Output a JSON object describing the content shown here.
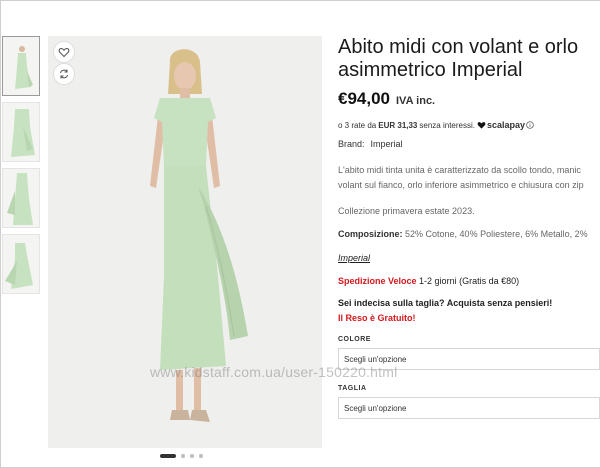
{
  "product": {
    "title_line1": "Abito midi con volant e orlo",
    "title_line2": "asimmetrico Imperial",
    "price": "€94,00",
    "vat": "IVA inc.",
    "rate_prefix": "o 3 rate da",
    "rate_amount": "EUR 31,33",
    "rate_suffix": "senza interessi.",
    "scalapay_label": "scalapay",
    "brand_label": "Brand:",
    "brand_value": "Imperial",
    "description_line1": "L'abito midi tinta unita è caratterizzato da scollo tondo, manic",
    "description_line2": "volant sul fianco, orlo inferiore asimmetrico e chiusura con zip",
    "collection": "Collezione primavera estate 2023.",
    "composition_label": "Composizione:",
    "composition_value": "52% Cotone, 40% Poliestere, 6% Metallo, 2%",
    "brand_link": "Imperial"
  },
  "shipping": {
    "fast_label": "Spedizione Veloce",
    "fast_detail": "1-2 giorni (Gratis da €80)",
    "size_doubt": "Sei indecisa sulla taglia? Acquista senza pensieri!",
    "free_return": "Il Reso è Gratuito!"
  },
  "options": {
    "color_label": "COLORE",
    "color_value": "Scegli un'opzione",
    "size_label": "TAGLIA",
    "size_value": "Scegli un'opzione"
  },
  "watermark": "www.kidstaff.com.ua/user-150220.html",
  "gallery": {
    "slide_count": 4,
    "active_slide": 1
  },
  "icons": {
    "wishlist": "heart-icon",
    "compare": "refresh-icon",
    "scalapay": "heart-filled-icon",
    "info": "info-icon"
  },
  "colors": {
    "accent_red": "#d3191d",
    "dress_green": "#c7e2c0"
  }
}
